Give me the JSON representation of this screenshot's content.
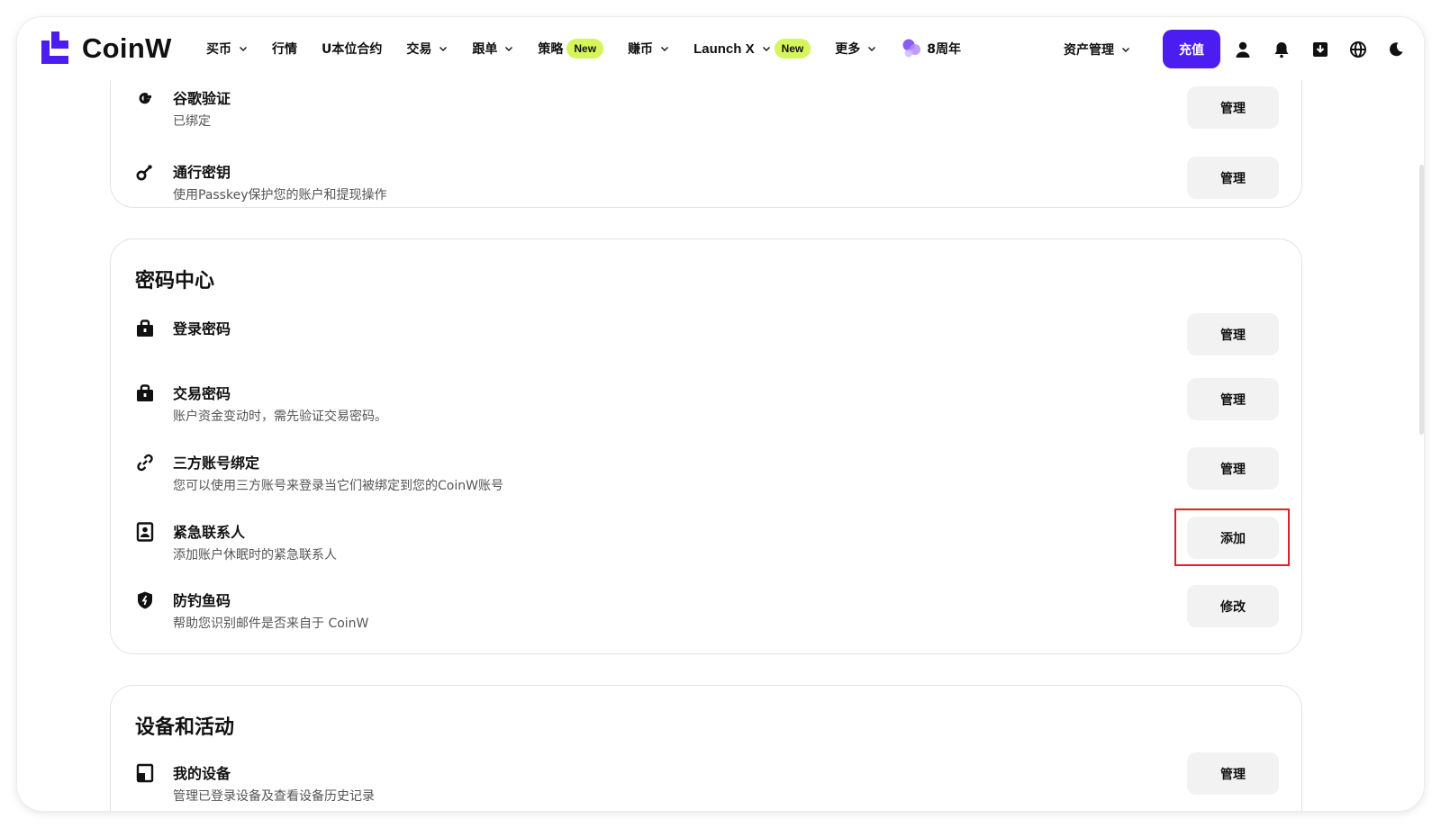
{
  "brand": {
    "name": "CoinW",
    "accent": "#4b1df0"
  },
  "nav": {
    "items": [
      {
        "label": "买币",
        "chevron": true
      },
      {
        "label": "行情",
        "chevron": false
      },
      {
        "label": "U本位合约",
        "chevron": false
      },
      {
        "label": "交易",
        "chevron": true
      },
      {
        "label": "跟单",
        "chevron": true
      },
      {
        "label": "策略",
        "badge": "New"
      },
      {
        "label": "赚币",
        "chevron": true
      },
      {
        "label": "Launch X",
        "chevron": true,
        "badge": "New"
      },
      {
        "label": "更多",
        "chevron": true
      }
    ],
    "anniversary": "8周年",
    "asset_management": "资产管理",
    "deposit": "充值"
  },
  "top_icons": [
    "user-icon",
    "bell-icon",
    "download-icon",
    "globe-icon",
    "moon-icon"
  ],
  "security_card": {
    "rows": [
      {
        "title": "谷歌验证",
        "desc": "已绑定",
        "button": "管理",
        "icon": "google-icon"
      },
      {
        "title": "通行密钥",
        "desc": "使用Passkey保护您的账户和提现操作",
        "button": "管理",
        "icon": "key-icon"
      }
    ]
  },
  "password_center": {
    "title": "密码中心",
    "rows": [
      {
        "title": "登录密码",
        "desc": "",
        "button": "管理",
        "icon": "lock-icon"
      },
      {
        "title": "交易密码",
        "desc": "账户资金变动时，需先验证交易密码。",
        "button": "管理",
        "icon": "lock-icon"
      },
      {
        "title": "三方账号绑定",
        "desc": "您可以使用三方账号来登录当它们被绑定到您的CoinW账号",
        "button": "管理",
        "icon": "link-icon"
      },
      {
        "title": "紧急联系人",
        "desc": "添加账户休眠时的紧急联系人",
        "button": "添加",
        "icon": "contact-icon"
      },
      {
        "title": "防钓鱼码",
        "desc": "帮助您识别邮件是否来自于 CoinW",
        "button": "修改",
        "icon": "shield-icon"
      }
    ]
  },
  "devices": {
    "title": "设备和活动",
    "rows": [
      {
        "title": "我的设备",
        "desc": "管理已登录设备及查看设备历史记录",
        "button": "管理",
        "icon": "device-icon"
      }
    ]
  },
  "colors": {
    "highlight": "#e0202a",
    "badge": "#d6f55a",
    "button_bg": "#f2f2f2"
  }
}
